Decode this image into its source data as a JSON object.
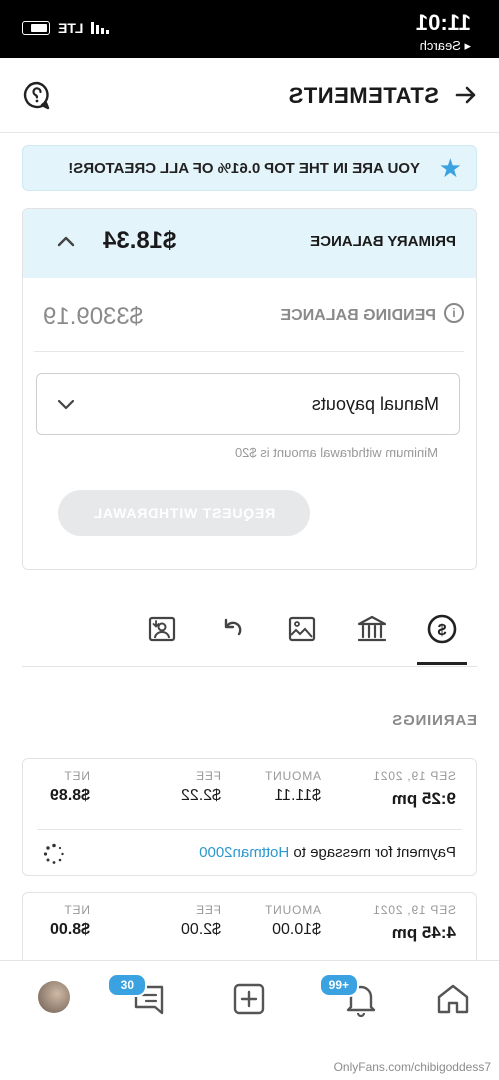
{
  "status_bar": {
    "time": "11:01",
    "back_label": "◂ Search",
    "network": "LTE"
  },
  "header": {
    "title": "STATEMENTS"
  },
  "banner": {
    "text": "YOU ARE IN THE TOP 0.61% OF ALL CREATORS!"
  },
  "balance": {
    "primary_label": "PRIMARY BALANCE",
    "primary_amount": "$18.34",
    "pending_label": "PENDING BALANCE",
    "pending_amount": "$3309.19",
    "payout_select": "Manual payouts",
    "min_hint": "Minimum withdrawal amount is $20",
    "withdraw_button": "REQUEST WITHDRAWAL"
  },
  "tabs": [
    {
      "icon": "dollar-circle-icon",
      "active": true
    },
    {
      "icon": "bank-icon",
      "active": false
    },
    {
      "icon": "image-icon",
      "active": false
    },
    {
      "icon": "redo-arrow-icon",
      "active": false
    },
    {
      "icon": "person-download-icon",
      "active": false
    }
  ],
  "section_title": "EARNINGS",
  "columns": {
    "date": "",
    "amount": "AMOUNT",
    "fee": "FEE",
    "net": "NET"
  },
  "transactions": [
    {
      "date": "SEP 19, 2021",
      "time": "9:25 pm",
      "amount": "$11.11",
      "fee": "$2.22",
      "net": "$8.89",
      "desc_prefix": "Payment for message to ",
      "desc_user": "Hottman2000"
    },
    {
      "date": "SEP 19, 2021",
      "time": "4:45 pm",
      "amount": "$10.00",
      "fee": "$2.00",
      "net": "$8.00"
    }
  ],
  "bottom_nav": {
    "notifications_badge": "99+",
    "messages_badge": "30"
  },
  "watermark": "OnlyFans.com/chibigoddess7"
}
